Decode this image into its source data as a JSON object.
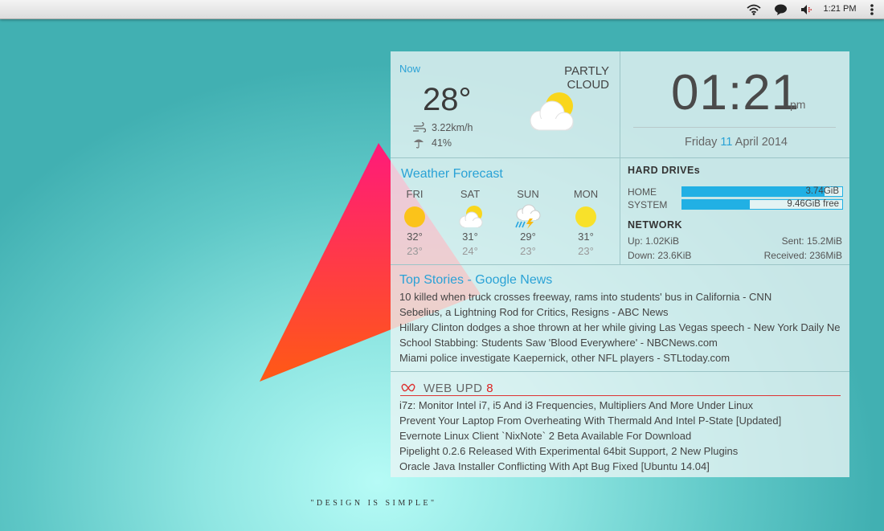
{
  "panel": {
    "clock": "1:21 PM",
    "icons": [
      "wifi-icon",
      "chat-icon",
      "volume-icon",
      "menu-dots-icon"
    ]
  },
  "weather_now": {
    "label": "Now",
    "temperature": "28°",
    "condition": "PARTLY CLOUD",
    "wind": "3.22km/h",
    "rain": "41%",
    "icon": "partly-cloudy-icon"
  },
  "clock": {
    "time": "01:21",
    "ampm": "pm",
    "date_prefix": "Friday",
    "date_day": "11",
    "date_suffix": "April 2014"
  },
  "forecast": {
    "title": "Weather Forecast",
    "days": [
      {
        "name": "FRI",
        "high": "32°",
        "low": "23°",
        "icon": "sunny-icon"
      },
      {
        "name": "SAT",
        "high": "31°",
        "low": "24°",
        "icon": "partly-cloudy-icon"
      },
      {
        "name": "SUN",
        "high": "29°",
        "low": "23°",
        "icon": "thunderstorm-icon"
      },
      {
        "name": "MON",
        "high": "31°",
        "low": "23°",
        "icon": "sunny-icon"
      }
    ]
  },
  "drives": {
    "title": "HARD DRIVEs",
    "items": [
      {
        "label": "HOME",
        "value": "3.74GiB",
        "fill": 0.89
      },
      {
        "label": "SYSTEM",
        "value": "9.46GiB free",
        "fill": 0.42
      }
    ]
  },
  "network": {
    "title": "NETWORK",
    "up": "Up: 1.02KiB",
    "down": "Down: 23.6KiB",
    "sent": "Sent: 15.2MiB",
    "received": "Received: 236MiB"
  },
  "news": {
    "title": "Top Stories - Google News",
    "items": [
      "10 killed when truck crosses freeway, rams into students' bus in California - CNN",
      "Sebelius, a Lightning Rod for Critics, Resigns - ABC News",
      "Hillary Clinton dodges a shoe thrown at her while giving Las Vegas speech - New York Daily Ne",
      "School Stabbing: Students Saw 'Blood Everywhere' - NBCNews.com",
      "Miami police investigate Kaepernick, other NFL players - STLtoday.com"
    ]
  },
  "webupd8": {
    "title": "WEB UPD",
    "title_num": "8",
    "items": [
      "i7z: Monitor Intel i7, i5 And i3 Frequencies, Multipliers And More Under Linux",
      "Prevent Your Laptop From Overheating With Thermald And Intel P-State [Updated]",
      "Evernote Linux Client `NixNote` 2 Beta Available For Download",
      "Pipelight 0.2.6 Released With Experimental 64bit Support, 2 New Plugins",
      "Oracle Java Installer Conflicting With Apt Bug Fixed [Ubuntu 14.04]"
    ]
  },
  "tagline": "\"DESIGN IS SIMPLE\"",
  "colors": {
    "accent": "#2aa2d6",
    "drive_bar": "#21b0e4",
    "webupd8_red": "#dd2222",
    "triangle_top": "#ff1a7a",
    "triangle_bottom": "#ff5a14"
  }
}
